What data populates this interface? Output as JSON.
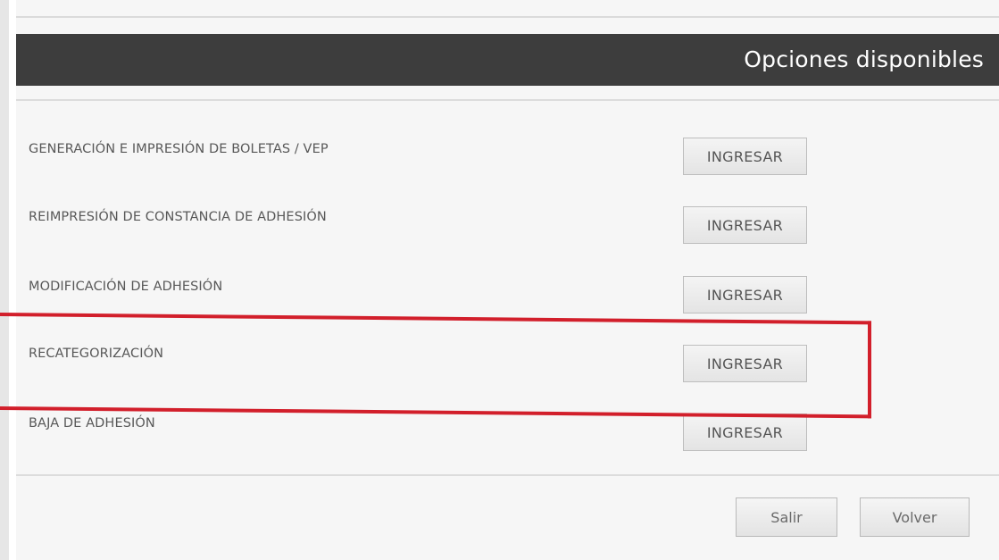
{
  "header": {
    "title": "Opciones disponibles"
  },
  "options": [
    {
      "label": "GENERACIÓN E IMPRESIÓN DE BOLETAS / VEP",
      "button": "INGRESAR"
    },
    {
      "label": "REIMPRESIÓN DE CONSTANCIA DE ADHESIÓN",
      "button": "INGRESAR"
    },
    {
      "label": "MODIFICACIÓN DE ADHESIÓN",
      "button": "INGRESAR"
    },
    {
      "label": "RECATEGORIZACIÓN",
      "button": "INGRESAR"
    },
    {
      "label": "BAJA DE ADHESIÓN",
      "button": "INGRESAR"
    }
  ],
  "footer": {
    "exit_label": "Salir",
    "back_label": "Volver"
  },
  "colors": {
    "header_bg": "#3d3d3d",
    "highlight": "#d21f2b"
  }
}
